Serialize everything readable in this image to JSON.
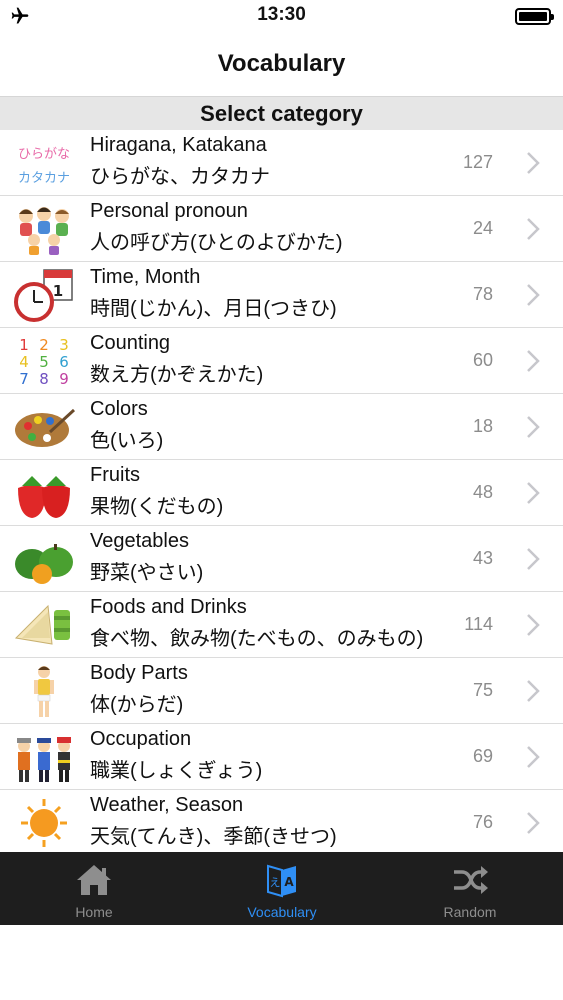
{
  "status_bar": {
    "time": "13:30"
  },
  "nav": {
    "title": "Vocabulary"
  },
  "section": {
    "header": "Select category"
  },
  "categories": [
    {
      "title": "Hiragana, Katakana",
      "subtitle": "ひらがな、カタカナ",
      "count": "127",
      "thumb_hira": "ひらがな",
      "thumb_kata": "カタカナ"
    },
    {
      "title": "Personal pronoun",
      "subtitle": "人の呼び方(ひとのよびかた)",
      "count": "24"
    },
    {
      "title": "Time, Month",
      "subtitle": "時間(じかん)、月日(つきひ)",
      "count": "78",
      "thumb_day": "1"
    },
    {
      "title": "Counting",
      "subtitle": "数え方(かぞえかた)",
      "count": "60",
      "thumb_digits": [
        "1",
        "2",
        "3",
        "4",
        "5",
        "6",
        "7",
        "8",
        "9"
      ]
    },
    {
      "title": "Colors",
      "subtitle": "色(いろ)",
      "count": "18"
    },
    {
      "title": "Fruits",
      "subtitle": "果物(くだもの)",
      "count": "48"
    },
    {
      "title": "Vegetables",
      "subtitle": "野菜(やさい)",
      "count": "43"
    },
    {
      "title": "Foods and Drinks",
      "subtitle": "食べ物、飲み物(たべもの、のみもの)",
      "count": "114"
    },
    {
      "title": "Body Parts",
      "subtitle": "体(からだ)",
      "count": "75"
    },
    {
      "title": "Occupation",
      "subtitle": "職業(しょくぎょう)",
      "count": "69"
    },
    {
      "title": "Weather, Season",
      "subtitle": "天気(てんき)、季節(きせつ)",
      "count": "76"
    }
  ],
  "tabs": [
    {
      "label": "Home",
      "icon": "home-icon"
    },
    {
      "label": "Vocabulary",
      "icon": "vocabulary-icon",
      "active": true
    },
    {
      "label": "Random",
      "icon": "shuffle-icon"
    }
  ],
  "icon_glyphs": {
    "vocab_ja": "え",
    "vocab_en": "A"
  },
  "colors": {
    "tab_active": "#2f8ff5",
    "tab_inactive": "#8e8e8e",
    "tab_bar": "#1e1e1e",
    "section_header": "#e6e6e6"
  }
}
